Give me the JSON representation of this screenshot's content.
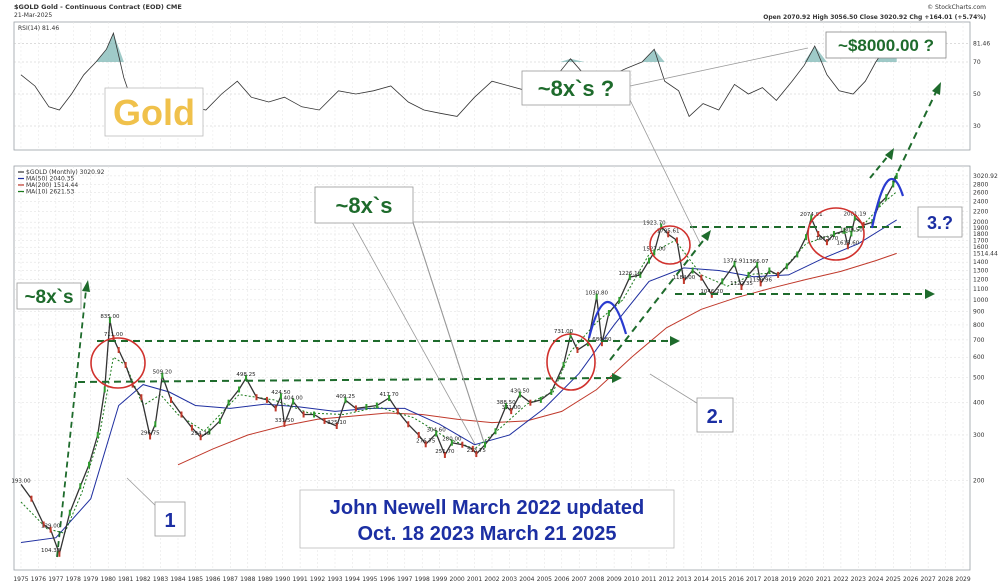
{
  "header": {
    "symbol_line": "$GOLD Gold - Continuous Contract (EOD) CME",
    "date": "21-Mar-2025",
    "watermark": "© StockCharts.com",
    "ohlc": "Open 2070.92  High 3056.50  Close 3020.92  Chg +164.01 (+5.74%)"
  },
  "rsi_panel": {
    "legend": "RSI(14) 81.46",
    "ticks": [
      "81.46",
      "70",
      "50",
      "30"
    ],
    "tick_values": [
      81.46,
      70,
      50,
      30
    ],
    "overlay_title": "Gold",
    "target_label": "~$8000.00 ?"
  },
  "price_panel": {
    "legend": [
      {
        "text": "$GOLD (Monthly) 3020.92",
        "color": "#333333"
      },
      {
        "text": "MA(50) 2040.35",
        "color": "#1f2fa0"
      },
      {
        "text": "MA(200) 1514.44",
        "color": "#c0392b"
      },
      {
        "text": "MA(10) 2621.53",
        "color": "#1a7a1a"
      }
    ],
    "y_ticks": [
      "3020.92",
      "2800",
      "2600",
      "2400",
      "2200",
      "2000",
      "1900",
      "1800",
      "1700",
      "1600",
      "1514.44",
      "1400",
      "1300",
      "1200",
      "1100",
      "1000",
      "900",
      "800",
      "700",
      "600",
      "500",
      "400",
      "300",
      "200"
    ],
    "y_tick_values": [
      3020.92,
      2800,
      2600,
      2400,
      2200,
      2000,
      1900,
      1800,
      1700,
      1600,
      1514.44,
      1400,
      1300,
      1200,
      1100,
      1000,
      900,
      800,
      700,
      600,
      500,
      400,
      300,
      200
    ],
    "x_ticks": [
      "1975",
      "1976",
      "1977",
      "1978",
      "1979",
      "1980",
      "1981",
      "1982",
      "1983",
      "1984",
      "1985",
      "1986",
      "1987",
      "1988",
      "1989",
      "1990",
      "1991",
      "1992",
      "1993",
      "1994",
      "1995",
      "1996",
      "1997",
      "1998",
      "1999",
      "2000",
      "2001",
      "2002",
      "2003",
      "2004",
      "2005",
      "2006",
      "2007",
      "2008",
      "2009",
      "2010",
      "2011",
      "2012",
      "2013",
      "2014",
      "2015",
      "2016",
      "2017",
      "2018",
      "2019",
      "2020",
      "2021",
      "2022",
      "2023",
      "2024",
      "2025",
      "2026",
      "2027",
      "2028",
      "2029"
    ],
    "price_labels": [
      {
        "t": "193.00",
        "x": 1975.0,
        "y": 193
      },
      {
        "t": "129.00",
        "x": 1976.7,
        "y": 129
      },
      {
        "t": "104.38",
        "x": 1976.7,
        "y": 104
      },
      {
        "t": "835.00",
        "x": 1980.1,
        "y": 835
      },
      {
        "t": "711.00",
        "x": 1980.3,
        "y": 711
      },
      {
        "t": "296.75",
        "x": 1982.4,
        "y": 296
      },
      {
        "t": "509.20",
        "x": 1983.1,
        "y": 509
      },
      {
        "t": "294.20",
        "x": 1985.3,
        "y": 294
      },
      {
        "t": "498.25",
        "x": 1987.9,
        "y": 498
      },
      {
        "t": "424.50",
        "x": 1989.9,
        "y": 424
      },
      {
        "t": "404.00",
        "x": 1990.6,
        "y": 404
      },
      {
        "t": "331.50",
        "x": 1990.1,
        "y": 331
      },
      {
        "t": "325.10",
        "x": 1993.1,
        "y": 325
      },
      {
        "t": "409.25",
        "x": 1993.6,
        "y": 409
      },
      {
        "t": "417.70",
        "x": 1996.1,
        "y": 417
      },
      {
        "t": "280.00",
        "x": 1999.7,
        "y": 280
      },
      {
        "t": "304.60",
        "x": 1998.8,
        "y": 304
      },
      {
        "t": "276.75",
        "x": 1998.2,
        "y": 276
      },
      {
        "t": "251.70",
        "x": 1999.3,
        "y": 251
      },
      {
        "t": "253.75",
        "x": 2001.1,
        "y": 253
      },
      {
        "t": "388.50",
        "x": 2002.8,
        "y": 388
      },
      {
        "t": "430.50",
        "x": 2003.6,
        "y": 430
      },
      {
        "t": "371.00",
        "x": 2003.1,
        "y": 371
      },
      {
        "t": "731.00",
        "x": 2006.1,
        "y": 731
      },
      {
        "t": "1030.80",
        "x": 2008.0,
        "y": 1030
      },
      {
        "t": "680.80",
        "x": 2008.3,
        "y": 680
      },
      {
        "t": "1226.10",
        "x": 2009.9,
        "y": 1226
      },
      {
        "t": "1923.70",
        "x": 2011.3,
        "y": 1923
      },
      {
        "t": "1795.61",
        "x": 2012.1,
        "y": 1795
      },
      {
        "t": "1527.00",
        "x": 2011.3,
        "y": 1527
      },
      {
        "t": "1184.00",
        "x": 2013.0,
        "y": 1184
      },
      {
        "t": "1374.91",
        "x": 2015.9,
        "y": 1374
      },
      {
        "t": "1046.20",
        "x": 2014.6,
        "y": 1046
      },
      {
        "t": "1122.35",
        "x": 2016.3,
        "y": 1122
      },
      {
        "t": "1366.07",
        "x": 2017.2,
        "y": 1366
      },
      {
        "t": "1159.96",
        "x": 2017.4,
        "y": 1159
      },
      {
        "t": "2074.91",
        "x": 2020.3,
        "y": 2074
      },
      {
        "t": "1673.70",
        "x": 2021.2,
        "y": 1673
      },
      {
        "t": "2081.19",
        "x": 2022.8,
        "y": 2081
      },
      {
        "t": "1613.60",
        "x": 2022.4,
        "y": 1613
      },
      {
        "t": "1809.50",
        "x": 2022.6,
        "y": 1809
      }
    ]
  },
  "annotations": {
    "e1": "~8x`s",
    "e2": "~8x`s",
    "e3": "~8x`s ?",
    "w1": "1",
    "w2": "2.",
    "w3": "3.?",
    "author_line1": "John Newell March 2022 updated",
    "author_line2": "Oct. 18 2023 March 21 2025"
  },
  "chart_data": {
    "type": "line",
    "title": "$GOLD Gold - Continuous Contract (EOD) CME",
    "xlabel": "",
    "ylabel": "",
    "y_scale": "log",
    "ylim": [
      90,
      3300
    ],
    "xlim": [
      1974.6,
      2029.4
    ],
    "series": [
      {
        "name": "$GOLD (Monthly)",
        "color": "#333333",
        "x": [
          1975.0,
          1975.6,
          1976.3,
          1976.7,
          1977.2,
          1977.8,
          1978.4,
          1978.9,
          1979.4,
          1979.8,
          1980.1,
          1980.3,
          1980.6,
          1981.0,
          1981.4,
          1981.9,
          1982.4,
          1982.7,
          1983.1,
          1983.6,
          1984.2,
          1984.8,
          1985.3,
          1985.8,
          1986.4,
          1986.9,
          1987.5,
          1987.9,
          1988.5,
          1989.1,
          1989.6,
          1989.9,
          1990.1,
          1990.6,
          1991.2,
          1991.8,
          1992.4,
          1993.1,
          1993.6,
          1994.2,
          1994.8,
          1995.4,
          1996.1,
          1996.6,
          1997.2,
          1997.8,
          1998.2,
          1998.8,
          1999.3,
          1999.7,
          2000.3,
          2000.9,
          2001.1,
          2001.6,
          2002.2,
          2002.8,
          2003.1,
          2003.6,
          2004.2,
          2004.8,
          2005.4,
          2006.1,
          2006.5,
          2006.9,
          2007.5,
          2008.0,
          2008.3,
          2008.7,
          2009.3,
          2009.9,
          2010.5,
          2011.0,
          2011.3,
          2011.7,
          2012.1,
          2012.6,
          2013.0,
          2013.5,
          2014.0,
          2014.6,
          2015.2,
          2015.9,
          2016.3,
          2016.7,
          2017.2,
          2017.4,
          2017.9,
          2018.4,
          2018.9,
          2019.5,
          2020.0,
          2020.3,
          2020.7,
          2021.2,
          2021.6,
          2022.2,
          2022.4,
          2022.6,
          2022.8,
          2023.3,
          2023.8,
          2024.2,
          2024.6,
          2025.0,
          2025.2
        ],
        "y": [
          193,
          170,
          135,
          129,
          104,
          150,
          190,
          230,
          300,
          450,
          835,
          711,
          640,
          560,
          470,
          420,
          296,
          330,
          509,
          410,
          360,
          320,
          294,
          310,
          340,
          400,
          450,
          498,
          420,
          410,
          380,
          424,
          331,
          404,
          360,
          360,
          340,
          325,
          409,
          380,
          385,
          390,
          417,
          370,
          330,
          300,
          276,
          304,
          251,
          280,
          275,
          265,
          253,
          275,
          310,
          388,
          371,
          430,
          400,
          410,
          440,
          560,
          731,
          640,
          680,
          1030,
          680,
          890,
          1000,
          1226,
          1250,
          1420,
          1527,
          1923,
          1795,
          1700,
          1184,
          1300,
          1220,
          1046,
          1180,
          1374,
          1122,
          1250,
          1366,
          1159,
          1300,
          1250,
          1350,
          1500,
          1750,
          2074,
          1800,
          1673,
          1800,
          1850,
          1613,
          1809,
          2081,
          1950,
          2000,
          2350,
          2500,
          2800,
          3020
        ]
      },
      {
        "name": "MA(50)",
        "color": "#1f2fa0",
        "x": [
          1975.0,
          1977.0,
          1979.0,
          1980.6,
          1982.0,
          1983.5,
          1985.0,
          1987.0,
          1989.0,
          1991.0,
          1993.0,
          1995.0,
          1997.0,
          1999.0,
          2001.0,
          2003.0,
          2005.0,
          2007.0,
          2009.0,
          2011.0,
          2013.0,
          2015.0,
          2017.0,
          2019.0,
          2021.0,
          2023.0,
          2025.2
        ],
        "y": [
          115,
          120,
          170,
          390,
          470,
          440,
          390,
          380,
          395,
          385,
          370,
          380,
          380,
          330,
          275,
          300,
          380,
          520,
          800,
          1180,
          1330,
          1300,
          1230,
          1250,
          1450,
          1650,
          2040
        ]
      },
      {
        "name": "MA(200)",
        "color": "#c0392b",
        "x": [
          1984.0,
          1986.0,
          1988.0,
          1990.0,
          1992.0,
          1994.0,
          1996.0,
          1998.0,
          2000.0,
          2002.0,
          2004.0,
          2006.0,
          2008.0,
          2010.0,
          2012.0,
          2014.0,
          2016.0,
          2018.0,
          2020.0,
          2022.0,
          2024.0,
          2025.2
        ],
        "y": [
          230,
          265,
          300,
          325,
          345,
          355,
          365,
          360,
          345,
          335,
          340,
          370,
          450,
          600,
          780,
          920,
          1020,
          1110,
          1200,
          1290,
          1420,
          1514
        ]
      },
      {
        "name": "MA(10)",
        "color": "#1a7a1a",
        "x": [
          1975.0,
          1976.5,
          1977.5,
          1978.5,
          1979.5,
          1980.3,
          1981.0,
          1982.0,
          1983.0,
          1984.0,
          1985.5,
          1987.5,
          1989.5,
          1991.5,
          1993.5,
          1995.5,
          1997.5,
          1999.5,
          2001.0,
          2002.5,
          2004.0,
          2005.5,
          2006.5,
          2008.0,
          2009.5,
          2011.0,
          2012.5,
          2014.0,
          2015.5,
          2017.0,
          2018.5,
          2020.0,
          2021.5,
          2023.0,
          2024.5,
          2025.2
        ],
        "y": [
          165,
          130,
          125,
          180,
          300,
          600,
          560,
          390,
          430,
          360,
          310,
          430,
          410,
          365,
          360,
          385,
          350,
          290,
          265,
          320,
          395,
          440,
          630,
          820,
          1000,
          1500,
          1700,
          1250,
          1130,
          1260,
          1270,
          1650,
          1790,
          1860,
          2400,
          2621
        ]
      }
    ]
  },
  "rsi_data": {
    "name": "RSI(14)",
    "x": [
      1975.0,
      1975.8,
      1976.6,
      1977.2,
      1977.9,
      1978.6,
      1979.3,
      1979.9,
      1980.3,
      1980.9,
      1981.6,
      1982.4,
      1983.0,
      1983.9,
      1984.8,
      1985.6,
      1986.5,
      1987.4,
      1988.2,
      1989.2,
      1990.1,
      1991.1,
      1992.1,
      1993.2,
      1994.2,
      1995.2,
      1996.2,
      1997.2,
      1998.1,
      1999.0,
      2000.0,
      2001.0,
      2002.0,
      2003.0,
      2004.0,
      2005.0,
      2005.9,
      2006.5,
      2007.3,
      2008.2,
      2008.9,
      2009.7,
      2010.6,
      2011.3,
      2011.9,
      2012.7,
      2013.3,
      2014.1,
      2015.0,
      2015.9,
      2016.7,
      2017.5,
      2018.3,
      2019.2,
      2019.9,
      2020.5,
      2021.2,
      2021.9,
      2022.7,
      2023.4,
      2024.0,
      2024.5,
      2025.0,
      2025.2
    ],
    "y": [
      62,
      55,
      42,
      40,
      50,
      62,
      70,
      78,
      88,
      60,
      38,
      30,
      52,
      45,
      42,
      40,
      50,
      58,
      48,
      45,
      48,
      42,
      40,
      52,
      50,
      52,
      55,
      45,
      40,
      38,
      36,
      48,
      58,
      55,
      52,
      58,
      64,
      72,
      62,
      48,
      62,
      66,
      70,
      78,
      58,
      52,
      36,
      44,
      40,
      56,
      50,
      54,
      46,
      58,
      68,
      80,
      62,
      52,
      50,
      58,
      70,
      78,
      80,
      81.46
    ]
  }
}
